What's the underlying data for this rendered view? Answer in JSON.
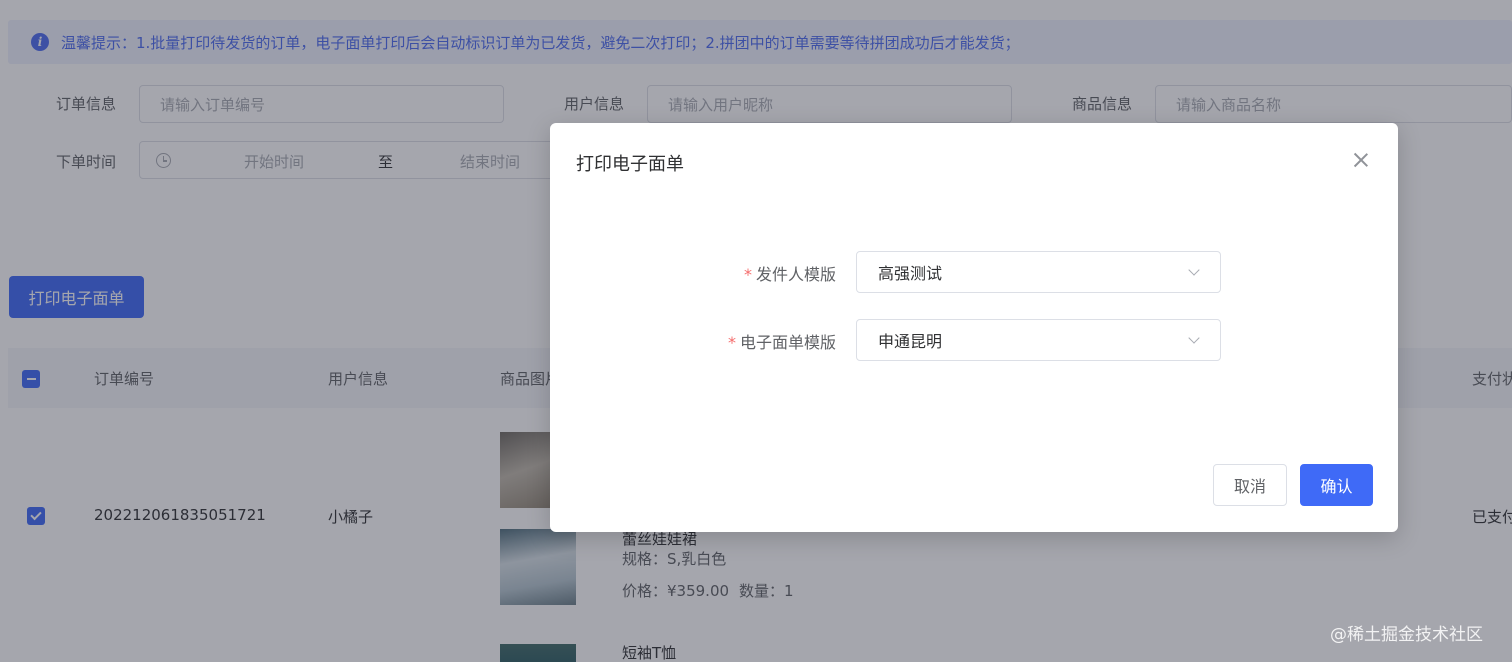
{
  "notice": {
    "text": "温馨提示：1.批量打印待发货的订单，电子面单打印后会自动标识订单为已发货，避免二次打印；2.拼团中的订单需要等待拼团成功后才能发货；"
  },
  "filters": {
    "order_info": {
      "label": "订单信息",
      "placeholder": "请输入订单编号"
    },
    "user_info": {
      "label": "用户信息",
      "placeholder": "请输入用户昵称"
    },
    "product_info": {
      "label": "商品信息",
      "placeholder": "请输入商品名称"
    },
    "order_time": {
      "label": "下单时间",
      "start": "开始时间",
      "separator": "至",
      "end": "结束时间"
    }
  },
  "toolbar": {
    "print_label": "打印电子面单"
  },
  "table": {
    "columns": [
      "订单编号",
      "用户信息",
      "商品图片",
      "支付状态"
    ],
    "rows": [
      {
        "order_no": "202212061835051721",
        "user": "小橘子",
        "pay_status": "已支付",
        "items": [
          {
            "name": "蕾丝娃娃裙",
            "spec": "规格：S,乳白色",
            "price_label": "价格：¥359.00",
            "qty_label": "数量：1"
          },
          {
            "name": "短袖T恤"
          }
        ]
      }
    ]
  },
  "dialog": {
    "title": "打印电子面单",
    "fields": [
      {
        "label": "发件人模版",
        "value": "高强测试"
      },
      {
        "label": "电子面单模版",
        "value": "申通昆明"
      }
    ],
    "cancel_label": "取消",
    "confirm_label": "确认"
  },
  "watermark": "@稀土掘金技术社区",
  "colors": {
    "primary": "#3f6af7",
    "required": "#f56c6c",
    "notice_bg": "#eef1fe"
  }
}
